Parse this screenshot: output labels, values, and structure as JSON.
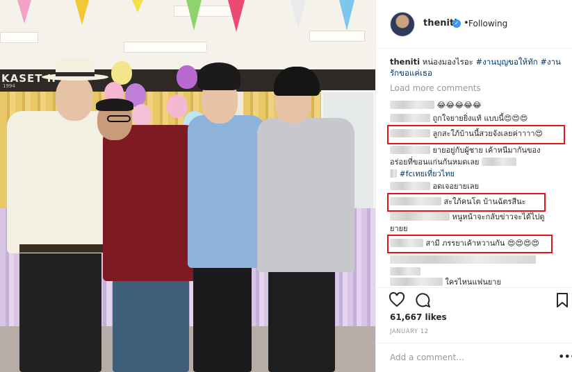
{
  "post": {
    "username": "theniti",
    "following_label": "Following",
    "separator": "•",
    "verified_glyph": "✓",
    "caption_text": "หน่องมองไรอะ",
    "caption_tag_1": "#งานบุญขอให้ทัก",
    "caption_tag_2": "#งานรักขอแค่เธอ",
    "load_more_label": "Load more comments",
    "likes": "61,667 likes",
    "date": "JANUARY 12",
    "add_comment_placeholder": "Add a comment...",
    "more_glyph": "•••"
  },
  "photo": {
    "banner_text": "KASET IP",
    "banner_subtext": "1994"
  },
  "comments": [
    {
      "text": "😂😂😂😂😂"
    },
    {
      "text": "ถูกใจยายยิ่งแท้ แบบนี้😍😍😍"
    },
    {
      "text": "ลูกสะใภ้บ้านนี้สวยจังเลยค่าาาา😍",
      "highlighted": true
    },
    {
      "text": "ยายอยู่กับผู้ชาย เค้าหนีมากันของ",
      "text2": "อร่อยที่ขอนแก่นกันหมดเลย",
      "tag": "#fcเทยเที่ยวไทย"
    },
    {
      "text": "อดเจอยายเลย"
    },
    {
      "text": "สะใภ้คนโต บ้านฉัตรสีนะ",
      "highlighted": true
    },
    {
      "text": "หนูหน้าจะกลับข่าวจะได้ไปดู",
      "text2": "ยายย"
    },
    {
      "text": "สามี ภรรยาเค้าหวานกัน 😍😍😍😍",
      "highlighted": true
    },
    {
      "text": "ใครไหนแฟนยาย"
    }
  ],
  "colors": {
    "highlight_border": "#e3141a",
    "hashtag": "#003569",
    "verified": "#3897f0",
    "muted": "#999999"
  },
  "icons": [
    "heart-icon",
    "comment-icon",
    "bookmark-icon",
    "verified-badge-icon",
    "more-options-icon"
  ]
}
